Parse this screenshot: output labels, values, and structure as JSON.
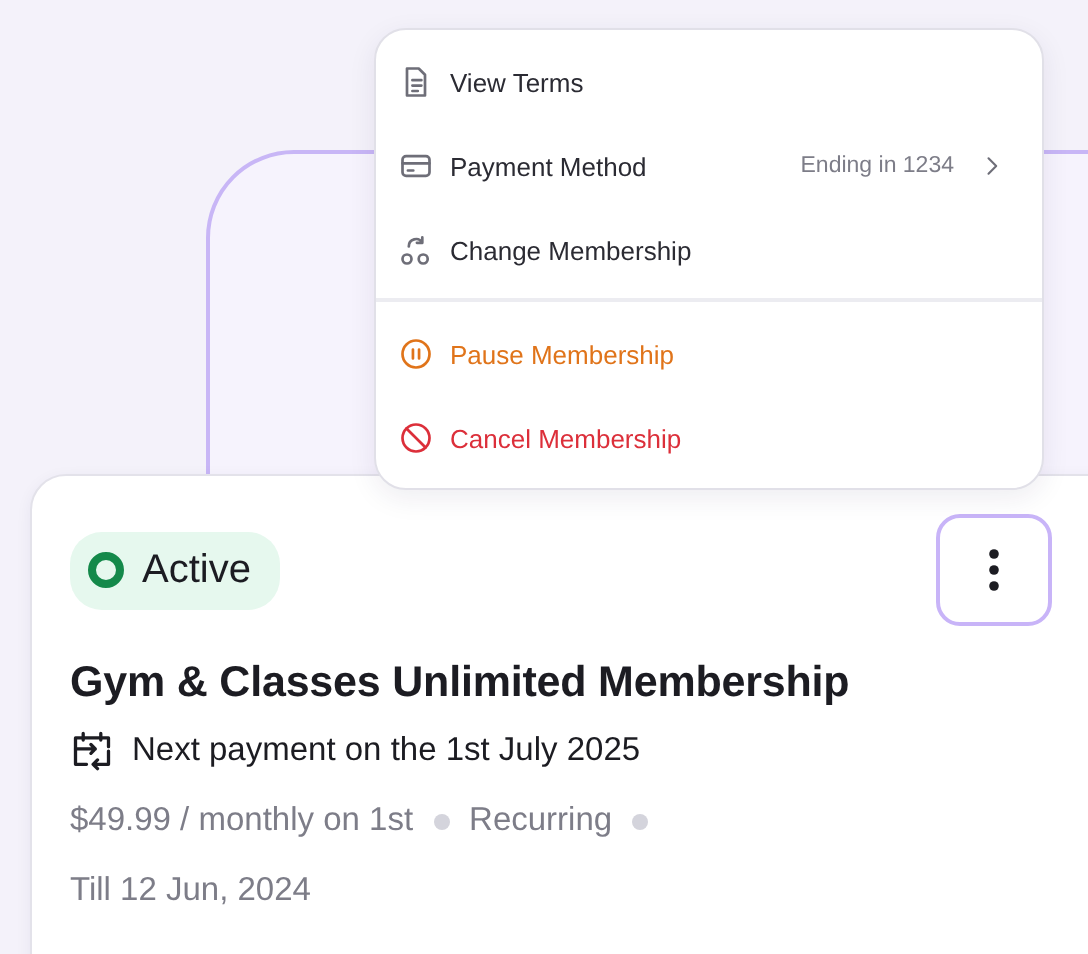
{
  "menu": {
    "groups": [
      [
        {
          "kind": "normal",
          "label": "View Terms"
        },
        {
          "kind": "normal",
          "label": "Payment Method",
          "detail": "Ending in 1234"
        },
        {
          "kind": "normal",
          "label": "Change Membership"
        }
      ],
      [
        {
          "kind": "warning",
          "label": "Pause Membership"
        },
        {
          "kind": "danger",
          "label": "Cancel Membership"
        }
      ]
    ]
  },
  "card": {
    "status": {
      "label": "Active"
    },
    "more_button": {
      "focused": true
    },
    "title": "Gym & Classes Unlimited Membership",
    "next_payment": "Next payment on the 1st July 2025",
    "meta": [
      "$49.99 / monthly on 1st",
      "Recurring"
    ],
    "end_date": "Till 12 Jun, 2024"
  }
}
